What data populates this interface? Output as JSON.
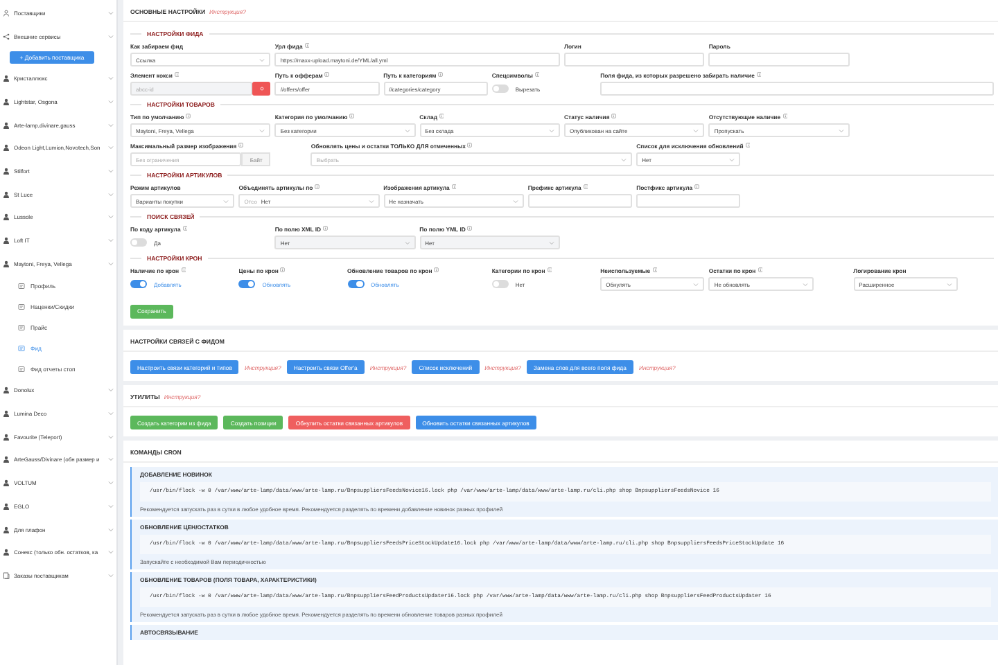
{
  "sidebar": {
    "items": [
      {
        "label": "Поставщики",
        "kind": "group"
      },
      {
        "label": "Внешние сервисы",
        "kind": "group"
      },
      {
        "label": "+ Добавить поставщика",
        "kind": "button"
      },
      {
        "label": "Кристаллюкс",
        "kind": "supplier"
      },
      {
        "label": "Lightstar, Osgona",
        "kind": "supplier"
      },
      {
        "label": "Arte-lamp,divinare,gauss",
        "kind": "supplier"
      },
      {
        "label": "Odeon Light,Lumion,Novotech,Son",
        "kind": "supplier"
      },
      {
        "label": "Stilfort",
        "kind": "supplier"
      },
      {
        "label": "St Luce",
        "kind": "supplier"
      },
      {
        "label": "Lussole",
        "kind": "supplier"
      },
      {
        "label": "Loft IT",
        "kind": "supplier"
      },
      {
        "label": "Maytoni, Freya, Vellega",
        "kind": "supplier",
        "children": [
          {
            "label": "Профиль",
            "kind": "page",
            "selected": false
          },
          {
            "label": "Наценки/Скидки",
            "kind": "page",
            "selected": false
          },
          {
            "label": "Прайс",
            "kind": "page",
            "selected": false
          },
          {
            "label": "Фид",
            "kind": "page",
            "selected": true
          },
          {
            "label": "Фид отчеты стоп",
            "kind": "page",
            "selected": false
          }
        ]
      },
      {
        "label": "Donolux",
        "kind": "supplier"
      },
      {
        "label": "Lumina Deco",
        "kind": "supplier"
      },
      {
        "label": "Favourite (Teleport)",
        "kind": "supplier"
      },
      {
        "label": "ArteGauss/Divinare (обн размер и",
        "kind": "supplier"
      },
      {
        "label": "VOLTUM",
        "kind": "supplier"
      },
      {
        "label": "EGLO",
        "kind": "supplier"
      },
      {
        "label": "Для плафон",
        "kind": "supplier"
      },
      {
        "label": "Сонекс (только обн. остатков, ка",
        "kind": "supplier"
      },
      {
        "label": "Заказы поставщикам",
        "kind": "group"
      }
    ]
  },
  "main_settings": {
    "title": "ОСНОВНЫЕ НАСТРОЙКИ",
    "instruction_link": "Инструкция?",
    "groups": [
      {
        "title": "НАСТРОЙКИ ФИДА",
        "rows": [
          {
            "fields": [
              {
                "label": "Как забираем фид",
                "info": false,
                "kind": "select",
                "value": "Ссылка",
                "disabled": false
              },
              {
                "label": "Урл фида",
                "info": true,
                "kind": "input",
                "value": "https://maxx-upload.maytoni.de/YML/all.yml",
                "disabled": false
              },
              {
                "label": "Логин",
                "info": false,
                "kind": "input",
                "disabled": false
              },
              {
                "label": "Пароль",
                "info": false,
                "kind": "input",
                "disabled": false
              }
            ]
          },
          {
            "fields": [
              {
                "label": "Элемент кокси",
                "info": true,
                "kind": "input-button",
                "placeholder": "abcc-id",
                "disabled": true
              },
              {
                "label": "Путь к офферам",
                "info": true,
                "kind": "input",
                "value": "//offers/offer",
                "disabled": false
              },
              {
                "label": "Путь к категориям",
                "info": true,
                "kind": "input",
                "value": "//categories/category",
                "disabled": false
              },
              {
                "label": "Спецсимволы",
                "info": true,
                "kind": "toggle",
                "on": false,
                "value": "Вырезать"
              },
              {
                "label": "Поля фида, из которых разрешено забирать наличие",
                "info": true,
                "kind": "input",
                "disabled": false
              }
            ]
          }
        ]
      },
      {
        "title": "НАСТРОЙКИ ТОВАРОВ",
        "rows": [
          {
            "fields": [
              {
                "label": "Тип по умолчанию",
                "info": true,
                "kind": "select",
                "value": "Maytoni, Freya, Vellega",
                "disabled": false
              },
              {
                "label": "Категория по умолчанию",
                "info": true,
                "kind": "select",
                "value": "Без категории",
                "disabled": false
              },
              {
                "label": "Склад",
                "info": true,
                "kind": "select",
                "value": "Без склада",
                "disabled": false
              },
              {
                "label": "Статус наличия",
                "info": true,
                "kind": "select",
                "value": "Опубликован на сайте",
                "disabled": false
              },
              {
                "label": "Отсутствующие наличие",
                "info": true,
                "kind": "select",
                "value": "Пропускать",
                "disabled": false
              }
            ]
          },
          {
            "fields": [
              {
                "label": "Максимальный размер изображения",
                "info": true,
                "kind": "input-addon",
                "placeholder": "Без ограничения",
                "addon": "Байт",
                "disabled": false
              },
              {
                "label": "Обновлять цены и остатки ТОЛЬКО ДЛЯ отмеченных",
                "info": true,
                "kind": "select",
                "placeholder": "Выбрать",
                "disabled": false
              },
              {
                "label": "Список для исключения обновлений",
                "info": true,
                "kind": "select",
                "value": "Нет",
                "disabled": false
              }
            ]
          }
        ]
      },
      {
        "title": "НАСТРОЙКИ АРТИКУЛОВ",
        "rows": [
          {
            "fields": [
              {
                "label": "Режим артикулов",
                "info": false,
                "kind": "select",
                "value": "Варианты покупки",
                "disabled": false
              },
              {
                "label": "Объединять артикулы по",
                "info": true,
                "kind": "select",
                "prefix": "Отсо",
                "value": "Нет",
                "disabled": false
              },
              {
                "label": "Изображения артикула",
                "info": true,
                "kind": "select",
                "value": "Не назначать",
                "disabled": false
              },
              {
                "label": "Префикс артикула",
                "info": true,
                "kind": "input",
                "disabled": false
              },
              {
                "label": "Постфикс артикула",
                "info": true,
                "kind": "input",
                "disabled": false
              }
            ]
          }
        ]
      },
      {
        "title": "ПОИСК СВЯЗЕЙ",
        "rows": [
          {
            "fields": [
              {
                "label": "По коду артикула",
                "info": true,
                "kind": "toggle",
                "on": false,
                "value": "Да"
              },
              {
                "label": "По полю XML ID",
                "info": true,
                "kind": "select",
                "value": "Нет",
                "disabled": true
              },
              {
                "label": "По полю YML ID",
                "info": true,
                "kind": "select",
                "value": "Нет",
                "disabled": true
              }
            ]
          }
        ]
      },
      {
        "title": "НАСТРОЙКИ КРОН",
        "rows": [
          {
            "fields": [
              {
                "label": "Наличие по крон",
                "info": true,
                "kind": "toggle",
                "on": true,
                "value": "Добавлять"
              },
              {
                "label": "Цены по крон",
                "info": true,
                "kind": "toggle",
                "on": true,
                "value": "Обновлять"
              },
              {
                "label": "Обновление товаров по крон",
                "info": true,
                "kind": "toggle",
                "on": true,
                "value": "Обновлять"
              },
              {
                "label": "Категории по крон",
                "info": true,
                "kind": "toggle",
                "on": false,
                "value": "Нет"
              },
              {
                "label": "Неиспользуемые",
                "info": true,
                "kind": "select",
                "value": "Обнулять",
                "disabled": false
              },
              {
                "label": "Остатки по крон",
                "info": true,
                "kind": "select",
                "value": "Не обновлять",
                "disabled": false
              },
              {
                "label": "Логирование крон",
                "info": false,
                "kind": "select",
                "value": "Расширенное",
                "disabled": false
              }
            ]
          }
        ]
      }
    ],
    "save_button": "Сохранить"
  },
  "feed_links": {
    "title": "НАСТРОЙКИ СВЯЗЕЙ С ФИДОМ",
    "buttons": [
      {
        "label": "Настроить связи категорий и типов",
        "link": "Инструкция?"
      },
      {
        "label": "Настроить связи Offer'a",
        "link": "Инструкция?"
      },
      {
        "label": "Список исключений",
        "link": "Инструкция?"
      },
      {
        "label": "Замена слов для всего поля фида",
        "link": "Инструкция?"
      }
    ]
  },
  "utilities": {
    "title": "УТИЛИТЫ",
    "instruction_link": "Инструкция?",
    "buttons": [
      {
        "label": "Создать категории из фида",
        "kind": "success"
      },
      {
        "label": "Создать позиции",
        "kind": "success"
      },
      {
        "label": "Обнулить остатки связанных артикулов",
        "kind": "danger"
      },
      {
        "label": "Обновить остатки связанных артикулов",
        "kind": "primary"
      }
    ]
  },
  "cron": {
    "title": "КОМАНДЫ CRON",
    "blocks": [
      {
        "title": "ДОБАВЛЕНИЕ НОВИНОК",
        "command": "/usr/bin/flock -w 0 /var/www/arte-lamp/data/www/arte-lamp.ru/BnpsuppliersFeedsNovice16.lock php /var/www/arte-lamp/data/www/arte-lamp.ru/cli.php shop BnpsuppliersFeedsNovice 16",
        "note": "Рекомендуется запускать раз в сутки в любое удобное время. Рекомендуется разделять по времени добавление новинок разных профилей"
      },
      {
        "title": "ОБНОВЛЕНИЕ ЦЕН/ОСТАТКОВ",
        "command": "/usr/bin/flock -w 0 /var/www/arte-lamp/data/www/arte-lamp.ru/BnpsuppliersFeedsPriceStockUpdate16.lock php /var/www/arte-lamp/data/www/arte-lamp.ru/cli.php shop BnpsuppliersFeedsPriceStockUpdate 16",
        "note": "Запускайте с необходимой Вам периодичностью"
      },
      {
        "title": "ОБНОВЛЕНИЕ ТОВАРОВ (ПОЛЯ ТОВАРА, ХАРАКТЕРИСТИКИ)",
        "command": "/usr/bin/flock -w 0 /var/www/arte-lamp/data/www/arte-lamp.ru/BnpsuppliersFeedProductsUpdater16.lock php /var/www/arte-lamp/data/www/arte-lamp.ru/cli.php shop BnpsuppliersFeedProductsUpdater 16",
        "note": "Рекомендуется запускать раз в сутки в любое удобное время. Рекомендуется разделять по времени обновление товаров разных профилей"
      },
      {
        "title": "АВТОСВЯЗЫВАНИЕ"
      }
    ]
  }
}
